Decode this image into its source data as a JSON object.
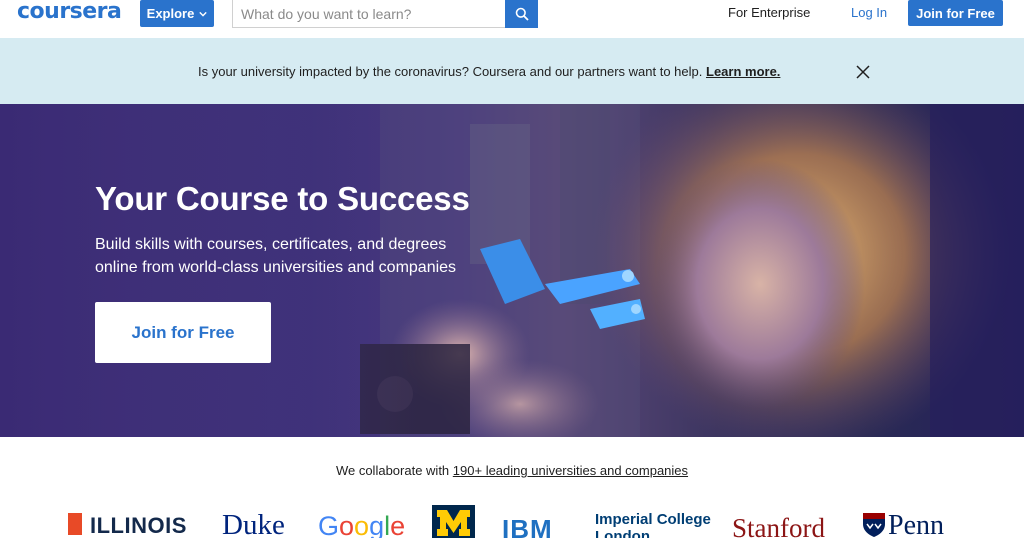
{
  "header": {
    "logo_text": "coursera",
    "explore_label": "Explore",
    "search_placeholder": "What do you want to learn?",
    "nav_enterprise": "For Enterprise",
    "nav_login": "Log In",
    "join_label": "Join for Free"
  },
  "banner": {
    "message": "Is your university impacted by the coronavirus? Coursera and our partners want to help.",
    "link_label": "Learn more."
  },
  "hero": {
    "title": "Your Course to Success",
    "subtitle_line1": "Build skills with courses, certificates, and degrees",
    "subtitle_line2": "online from world-class universities and companies",
    "cta_label": "Join for Free"
  },
  "partners": {
    "intro": "We collaborate with",
    "link_label": "190+ leading universities and companies",
    "logos": {
      "illinois": "ILLINOIS",
      "duke": "Duke",
      "google": [
        "G",
        "o",
        "o",
        "g",
        "l",
        "e"
      ],
      "umich": "M",
      "ibm": "IBM",
      "imperial_line1": "Imperial College",
      "imperial_line2": "London",
      "stanford": "Stanford",
      "penn": "Penn"
    }
  },
  "colors": {
    "brand_blue": "#2a73cc",
    "banner_bg": "#d6ebf2",
    "hero_purple": "#3c2f78"
  },
  "icons": {
    "explore_chevron": "chevron-down-icon",
    "search": "search-icon",
    "banner_close": "close-icon"
  }
}
